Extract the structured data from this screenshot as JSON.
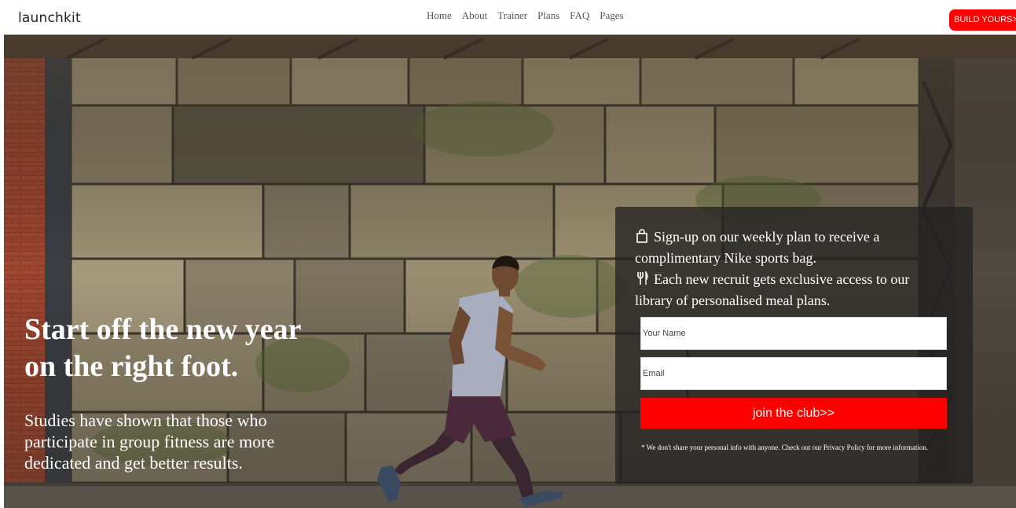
{
  "header": {
    "logo": "launchkit",
    "nav": [
      "Home",
      "About",
      "Trainer",
      "Plans",
      "FAQ",
      "Pages"
    ],
    "cta_label": "BUILD YOURS>>",
    "cta_color": "#ff0000"
  },
  "hero": {
    "headline_line1": "Start off the new year",
    "headline_line2": "on the right foot.",
    "subcopy": "Studies have shown that those who participate in group fitness are more dedicated and get better results."
  },
  "signup": {
    "perk1_icon": "shopping-bag-icon",
    "perk1_text": "Sign-up on our weekly plan to receive a complimentary Nike sports bag.",
    "perk2_icon": "fork-knife-icon",
    "perk2_text": "Each new recruit gets exclusive access to our library of personalised meal plans.",
    "name_placeholder": "Your Name",
    "email_placeholder": "Email",
    "submit_label": "join the club>>",
    "submit_color": "#ff0000",
    "disclaimer": "* We don't share your personal info with anyone. Check out our Privacy Policy for more information."
  }
}
